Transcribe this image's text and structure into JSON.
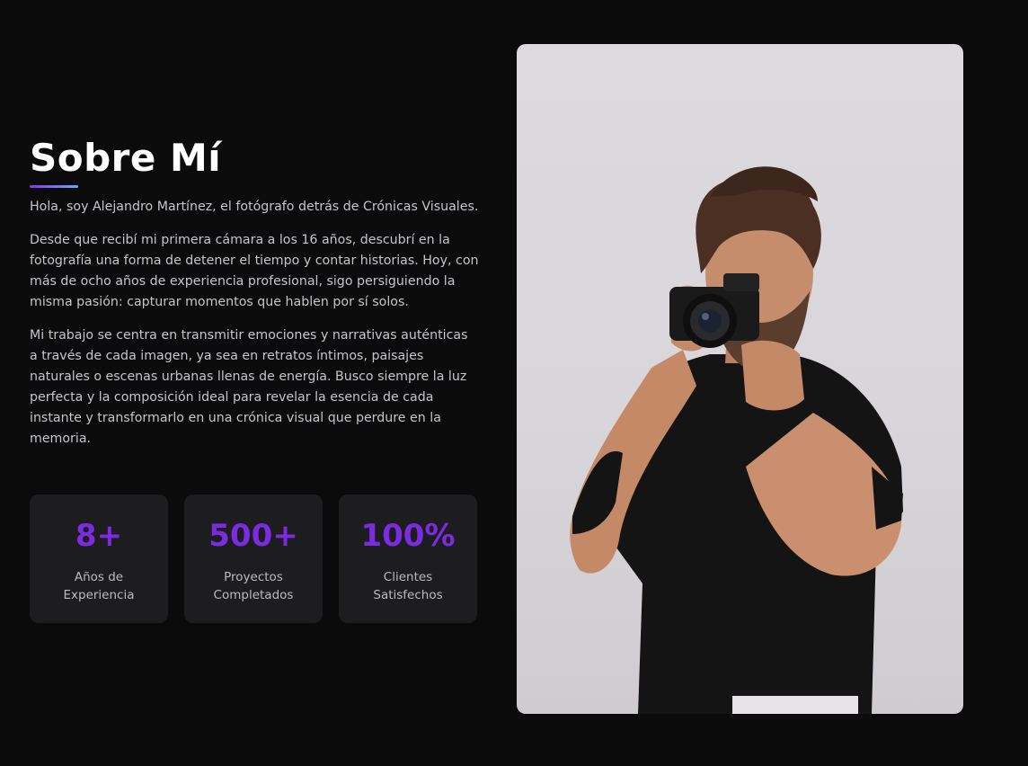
{
  "about": {
    "title": "Sobre Mí",
    "paragraphs": [
      "Hola, soy Alejandro Martínez, el fotógrafo detrás de Crónicas Visuales.",
      "Desde que recibí mi primera cámara a los 16 años, descubrí en la fotografía una forma de detener el tiempo y contar historias. Hoy, con más de ocho años de experiencia profesional, sigo persiguiendo la misma pasión: capturar momentos que hablen por sí solos.",
      "Mi trabajo se centra en transmitir emociones y narrativas auténticas a través de cada imagen, ya sea en retratos íntimos, paisajes naturales o escenas urbanas llenas de energía. Busco siempre la luz perfecta y la composición ideal para revelar la esencia de cada instante y transformarlo en una crónica visual que perdure en la memoria."
    ],
    "stats": [
      {
        "value": "8+",
        "label": "Años de Experiencia"
      },
      {
        "value": "500+",
        "label": "Proyectos Completados"
      },
      {
        "value": "100%",
        "label": "Clientes Satisfechos"
      }
    ],
    "photo_icon": "photographer-portrait-image"
  },
  "colors": {
    "background": "#0b0b0c",
    "accent": "#7b2be0",
    "card": "#1d1c1f",
    "underline_start": "#7c3aed",
    "underline_end": "#6aa8ff"
  }
}
